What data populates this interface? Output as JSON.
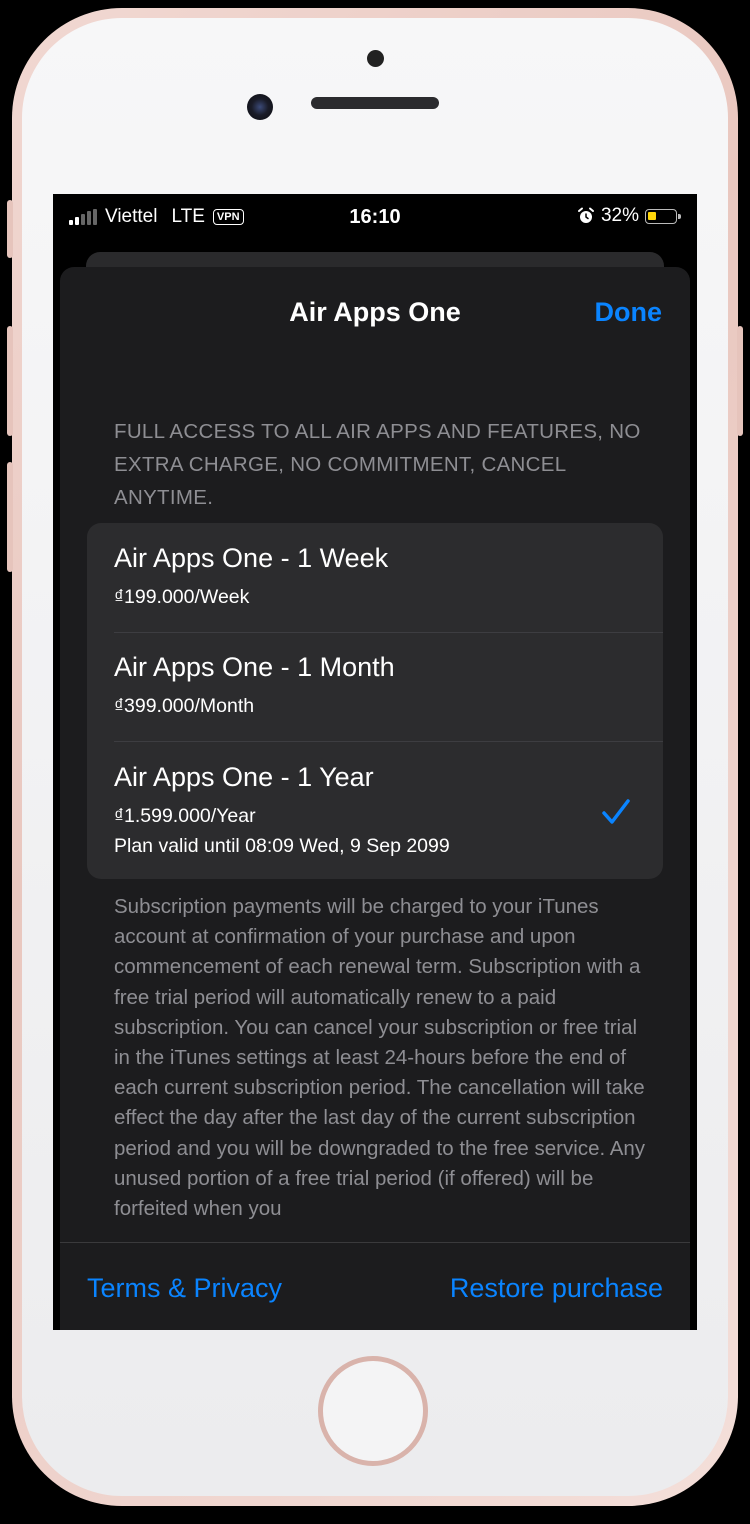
{
  "status": {
    "carrier": "Viettel",
    "network": "LTE",
    "vpn": "VPN",
    "time": "16:10",
    "battery": "32%",
    "battery_level": 0.32
  },
  "nav": {
    "title": "Air Apps One",
    "done_label": "Done"
  },
  "header_note": "FULL ACCESS TO ALL AIR APPS AND FEATURES, NO EXTRA CHARGE, NO COMMITMENT, CANCEL ANYTIME.",
  "plans": [
    {
      "name": "Air Apps One - 1 Week",
      "price": "₫199.000/Week",
      "selected": false
    },
    {
      "name": "Air Apps One - 1 Month",
      "price": "₫399.000/Month",
      "selected": false
    },
    {
      "name": "Air Apps One - 1 Year",
      "price": "₫1.599.000/Year",
      "valid": "Plan valid until 08:09 Wed, 9 Sep 2099",
      "selected": true
    }
  ],
  "legal_text": "Subscription payments will be charged to your iTunes account at confirmation of your purchase and upon commencement of each renewal term. Subscription with a free trial period will automatically renew to a paid subscription. You can cancel your subscription or free trial in the iTunes settings at least 24-hours before the end of each current subscription period. The cancellation will take effect the day after the last day of the current subscription period and you will be downgraded to the free service. Any unused portion of a free trial period (if offered) will be forfeited when you",
  "footer": {
    "terms_label": "Terms & Privacy",
    "restore_label": "Restore purchase"
  },
  "colors": {
    "accent": "#0a84ff",
    "sheet_bg": "#1c1c1e",
    "card_bg": "#2c2c2e",
    "secondary_text": "#8e8e93"
  }
}
